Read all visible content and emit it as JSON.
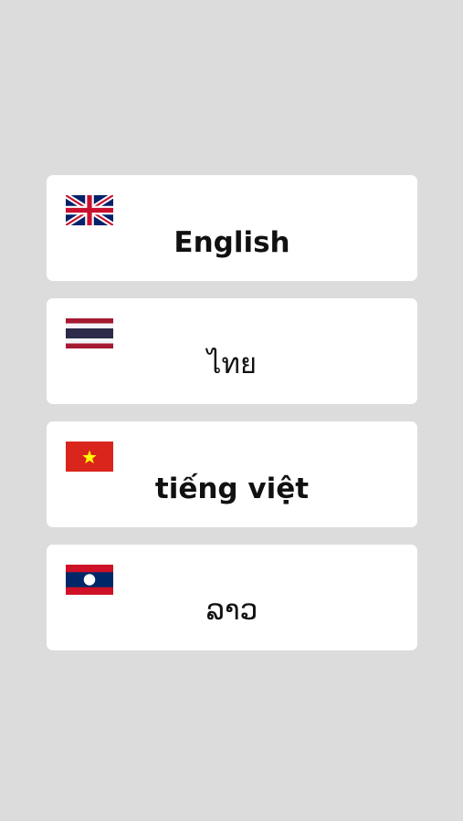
{
  "languages": [
    {
      "label": "English",
      "flag_icon": "uk-flag-icon"
    },
    {
      "label": "ไทย",
      "flag_icon": "thailand-flag-icon"
    },
    {
      "label": "tiếng việt",
      "flag_icon": "vietnam-flag-icon"
    },
    {
      "label": "ລາວ",
      "flag_icon": "laos-flag-icon"
    }
  ],
  "colors": {
    "background": "#dcdcdc",
    "card": "#ffffff",
    "text": "#111111"
  }
}
